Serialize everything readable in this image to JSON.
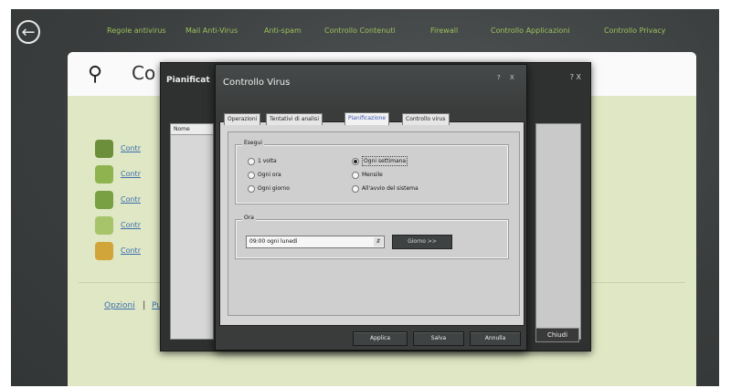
{
  "nav": {
    "back_icon": "back-arrow-icon",
    "items": [
      "Regole antivirus",
      "Mail Anti-Virus",
      "Anti-spam",
      "Controllo Contenuti",
      "Firewall",
      "Controllo Applicazioni",
      "Controllo Privacy"
    ]
  },
  "panel": {
    "title": "Co",
    "search_icon": "magnifier-icon",
    "items": [
      {
        "icon": "shield-bug-icon",
        "label": "Contr"
      },
      {
        "icon": "mail-icon",
        "label": "Contr"
      },
      {
        "icon": "hand-icon",
        "label": "Contr"
      },
      {
        "icon": "globe-icon",
        "label": "Contr"
      },
      {
        "icon": "user-icon",
        "label": "Contr"
      }
    ],
    "links": {
      "opzioni": "Opzioni",
      "separator": "|",
      "second": "Pu"
    }
  },
  "planner_window": {
    "title": "Pianificat",
    "column_header": "Nome",
    "controls": "? X",
    "close_button": "Chiudi"
  },
  "dialog": {
    "title": "Controllo Virus",
    "help": "?",
    "close": "X",
    "tabs": [
      {
        "label": "Operazioni",
        "active": false
      },
      {
        "label": "Tentativi di analisi",
        "active": false
      },
      {
        "label": "Pianificazione",
        "active": true
      },
      {
        "label": "Controllo virus",
        "active": false
      }
    ],
    "group_esegui": {
      "title": "Esegui",
      "options": [
        {
          "label": "1 volta",
          "checked": false
        },
        {
          "label": "Ogni ora",
          "checked": false
        },
        {
          "label": "Ogni giorno",
          "checked": false
        },
        {
          "label": "Ogni settimana",
          "checked": true
        },
        {
          "label": "Mensile",
          "checked": false
        },
        {
          "label": "All'avvio del sistema",
          "checked": false
        }
      ]
    },
    "group_ora": {
      "title": "Ora",
      "dropdown_value": "09:00 ogni lunedì",
      "day_button": "Giorno >>"
    },
    "buttons": {
      "apply": "Applica",
      "save": "Salva",
      "cancel": "Annulla"
    }
  },
  "colors": {
    "nav_text": "#9bc15c",
    "panel_bg": "#dfe7c4",
    "link": "#3b6fb0",
    "active_tab": "#3b56b5"
  }
}
